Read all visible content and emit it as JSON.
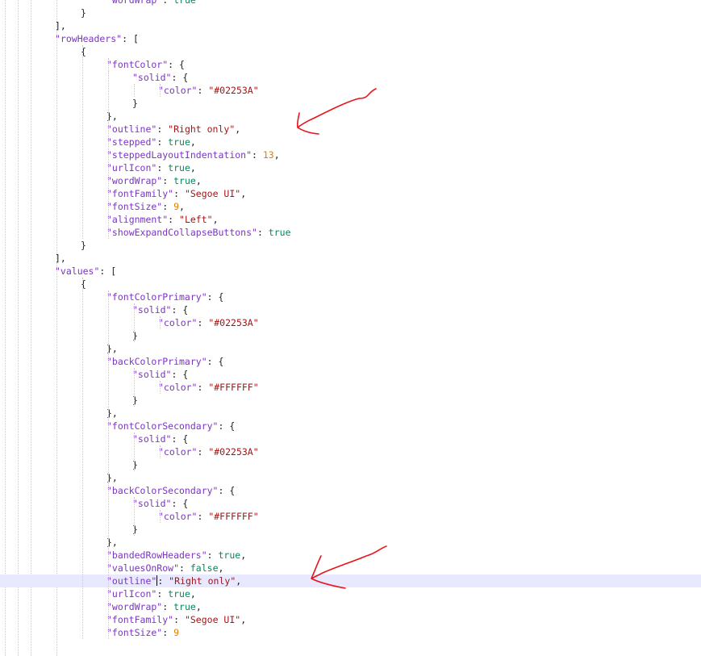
{
  "editor": {
    "highlight_line_index": 45,
    "lines": [
      {
        "indent": 4,
        "tokens": [
          [
            "prop",
            "\"wordWrap\""
          ],
          [
            "punc",
            ": "
          ],
          [
            "bool",
            "true"
          ]
        ]
      },
      {
        "indent": 3,
        "tokens": [
          [
            "punc",
            "}"
          ]
        ]
      },
      {
        "indent": 2,
        "tokens": [
          [
            "punc",
            "],"
          ]
        ]
      },
      {
        "indent": 2,
        "tokens": [
          [
            "prop",
            "\"rowHeaders\""
          ],
          [
            "punc",
            ": ["
          ]
        ]
      },
      {
        "indent": 3,
        "tokens": [
          [
            "punc",
            "{"
          ]
        ]
      },
      {
        "indent": 4,
        "tokens": [
          [
            "prop",
            "\"fontColor\""
          ],
          [
            "punc",
            ": {"
          ]
        ]
      },
      {
        "indent": 5,
        "tokens": [
          [
            "prop",
            "\"solid\""
          ],
          [
            "punc",
            ": {"
          ]
        ]
      },
      {
        "indent": 6,
        "tokens": [
          [
            "prop",
            "\"color\""
          ],
          [
            "punc",
            ": "
          ],
          [
            "str",
            "\"#02253A\""
          ]
        ]
      },
      {
        "indent": 5,
        "tokens": [
          [
            "punc",
            "}"
          ]
        ]
      },
      {
        "indent": 4,
        "tokens": [
          [
            "punc",
            "},"
          ]
        ]
      },
      {
        "indent": 4,
        "tokens": [
          [
            "prop",
            "\"outline\""
          ],
          [
            "punc",
            ": "
          ],
          [
            "str",
            "\"Right only\""
          ],
          [
            "punc",
            ","
          ]
        ]
      },
      {
        "indent": 4,
        "tokens": [
          [
            "prop",
            "\"stepped\""
          ],
          [
            "punc",
            ": "
          ],
          [
            "bool",
            "true"
          ],
          [
            "punc",
            ","
          ]
        ]
      },
      {
        "indent": 4,
        "tokens": [
          [
            "prop",
            "\"steppedLayoutIndentation\""
          ],
          [
            "punc",
            ": "
          ],
          [
            "num",
            "13"
          ],
          [
            "punc",
            ","
          ]
        ]
      },
      {
        "indent": 4,
        "tokens": [
          [
            "prop",
            "\"urlIcon\""
          ],
          [
            "punc",
            ": "
          ],
          [
            "bool",
            "true"
          ],
          [
            "punc",
            ","
          ]
        ]
      },
      {
        "indent": 4,
        "tokens": [
          [
            "prop",
            "\"wordWrap\""
          ],
          [
            "punc",
            ": "
          ],
          [
            "bool",
            "true"
          ],
          [
            "punc",
            ","
          ]
        ]
      },
      {
        "indent": 4,
        "tokens": [
          [
            "prop",
            "\"fontFamily\""
          ],
          [
            "punc",
            ": "
          ],
          [
            "str",
            "\"Segoe UI\""
          ],
          [
            "punc",
            ","
          ]
        ]
      },
      {
        "indent": 4,
        "tokens": [
          [
            "prop",
            "\"fontSize\""
          ],
          [
            "punc",
            ": "
          ],
          [
            "num",
            "9"
          ],
          [
            "punc",
            ","
          ]
        ]
      },
      {
        "indent": 4,
        "tokens": [
          [
            "prop",
            "\"alignment\""
          ],
          [
            "punc",
            ": "
          ],
          [
            "str",
            "\"Left\""
          ],
          [
            "punc",
            ","
          ]
        ]
      },
      {
        "indent": 4,
        "tokens": [
          [
            "prop",
            "\"showExpandCollapseButtons\""
          ],
          [
            "punc",
            ": "
          ],
          [
            "bool",
            "true"
          ]
        ]
      },
      {
        "indent": 3,
        "tokens": [
          [
            "punc",
            "}"
          ]
        ]
      },
      {
        "indent": 2,
        "tokens": [
          [
            "punc",
            "],"
          ]
        ]
      },
      {
        "indent": 2,
        "tokens": [
          [
            "prop",
            "\"values\""
          ],
          [
            "punc",
            ": ["
          ]
        ]
      },
      {
        "indent": 3,
        "tokens": [
          [
            "punc",
            "{"
          ]
        ]
      },
      {
        "indent": 4,
        "tokens": [
          [
            "prop",
            "\"fontColorPrimary\""
          ],
          [
            "punc",
            ": {"
          ]
        ]
      },
      {
        "indent": 5,
        "tokens": [
          [
            "prop",
            "\"solid\""
          ],
          [
            "punc",
            ": {"
          ]
        ]
      },
      {
        "indent": 6,
        "tokens": [
          [
            "prop",
            "\"color\""
          ],
          [
            "punc",
            ": "
          ],
          [
            "str",
            "\"#02253A\""
          ]
        ]
      },
      {
        "indent": 5,
        "tokens": [
          [
            "punc",
            "}"
          ]
        ]
      },
      {
        "indent": 4,
        "tokens": [
          [
            "punc",
            "},"
          ]
        ]
      },
      {
        "indent": 4,
        "tokens": [
          [
            "prop",
            "\"backColorPrimary\""
          ],
          [
            "punc",
            ": {"
          ]
        ]
      },
      {
        "indent": 5,
        "tokens": [
          [
            "prop",
            "\"solid\""
          ],
          [
            "punc",
            ": {"
          ]
        ]
      },
      {
        "indent": 6,
        "tokens": [
          [
            "prop",
            "\"color\""
          ],
          [
            "punc",
            ": "
          ],
          [
            "str",
            "\"#FFFFFF\""
          ]
        ]
      },
      {
        "indent": 5,
        "tokens": [
          [
            "punc",
            "}"
          ]
        ]
      },
      {
        "indent": 4,
        "tokens": [
          [
            "punc",
            "},"
          ]
        ]
      },
      {
        "indent": 4,
        "tokens": [
          [
            "prop",
            "\"fontColorSecondary\""
          ],
          [
            "punc",
            ": {"
          ]
        ]
      },
      {
        "indent": 5,
        "tokens": [
          [
            "prop",
            "\"solid\""
          ],
          [
            "punc",
            ": {"
          ]
        ]
      },
      {
        "indent": 6,
        "tokens": [
          [
            "prop",
            "\"color\""
          ],
          [
            "punc",
            ": "
          ],
          [
            "str",
            "\"#02253A\""
          ]
        ]
      },
      {
        "indent": 5,
        "tokens": [
          [
            "punc",
            "}"
          ]
        ]
      },
      {
        "indent": 4,
        "tokens": [
          [
            "punc",
            "},"
          ]
        ]
      },
      {
        "indent": 4,
        "tokens": [
          [
            "prop",
            "\"backColorSecondary\""
          ],
          [
            "punc",
            ": {"
          ]
        ]
      },
      {
        "indent": 5,
        "tokens": [
          [
            "prop",
            "\"solid\""
          ],
          [
            "punc",
            ": {"
          ]
        ]
      },
      {
        "indent": 6,
        "tokens": [
          [
            "prop",
            "\"color\""
          ],
          [
            "punc",
            ": "
          ],
          [
            "str",
            "\"#FFFFFF\""
          ]
        ]
      },
      {
        "indent": 5,
        "tokens": [
          [
            "punc",
            "}"
          ]
        ]
      },
      {
        "indent": 4,
        "tokens": [
          [
            "punc",
            "},"
          ]
        ]
      },
      {
        "indent": 4,
        "tokens": [
          [
            "prop",
            "\"bandedRowHeaders\""
          ],
          [
            "punc",
            ": "
          ],
          [
            "bool",
            "true"
          ],
          [
            "punc",
            ","
          ]
        ]
      },
      {
        "indent": 4,
        "tokens": [
          [
            "prop",
            "\"valuesOnRow\""
          ],
          [
            "punc",
            ": "
          ],
          [
            "bool",
            "false"
          ],
          [
            "punc",
            ","
          ]
        ]
      },
      {
        "indent": 4,
        "tokens": [
          [
            "prop",
            "\"outline\""
          ],
          [
            "caret",
            ""
          ],
          [
            "punc",
            ": "
          ],
          [
            "str",
            "\"Right only\""
          ],
          [
            "punc",
            ","
          ]
        ]
      },
      {
        "indent": 4,
        "tokens": [
          [
            "prop",
            "\"urlIcon\""
          ],
          [
            "punc",
            ": "
          ],
          [
            "bool",
            "true"
          ],
          [
            "punc",
            ","
          ]
        ]
      },
      {
        "indent": 4,
        "tokens": [
          [
            "prop",
            "\"wordWrap\""
          ],
          [
            "punc",
            ": "
          ],
          [
            "bool",
            "true"
          ],
          [
            "punc",
            ","
          ]
        ]
      },
      {
        "indent": 4,
        "tokens": [
          [
            "prop",
            "\"fontFamily\""
          ],
          [
            "punc",
            ": "
          ],
          [
            "str",
            "\"Segoe UI\""
          ],
          [
            "punc",
            ","
          ]
        ]
      },
      {
        "indent": 4,
        "tokens": [
          [
            "prop",
            "\"fontSize\""
          ],
          [
            "punc",
            ": "
          ],
          [
            "num",
            "9"
          ]
        ]
      },
      {
        "indent": 3,
        "tokens": [
          [
            "punc",
            ""
          ]
        ]
      }
    ]
  },
  "annotations": {
    "color": "#e8141a",
    "arrows": [
      {
        "points_to_line": 10
      },
      {
        "points_to_line": 45
      }
    ]
  }
}
